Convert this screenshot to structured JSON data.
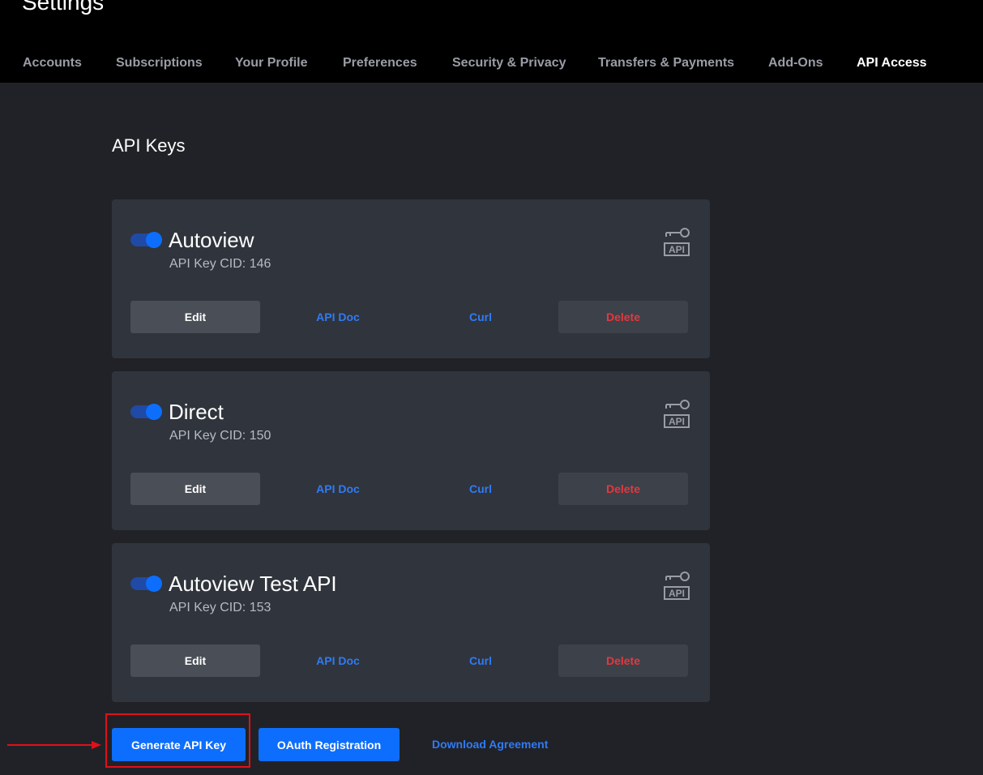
{
  "header": {
    "title": "Settings",
    "tabs": [
      {
        "label": "Accounts"
      },
      {
        "label": "Subscriptions"
      },
      {
        "label": "Your Profile"
      },
      {
        "label": "Preferences"
      },
      {
        "label": "Security & Privacy"
      },
      {
        "label": "Transfers & Payments"
      },
      {
        "label": "Add-Ons"
      },
      {
        "label": "API Access",
        "active": true
      }
    ]
  },
  "main": {
    "section_title": "API Keys",
    "keys": [
      {
        "name": "Autoview",
        "cid": "API Key CID: 146",
        "enabled": true,
        "edit": "Edit",
        "api_doc": "API Doc",
        "curl": "Curl",
        "delete": "Delete",
        "icon_label": "API"
      },
      {
        "name": "Direct",
        "cid": "API Key CID: 150",
        "enabled": true,
        "edit": "Edit",
        "api_doc": "API Doc",
        "curl": "Curl",
        "delete": "Delete",
        "icon_label": "API"
      },
      {
        "name": "Autoview Test API",
        "cid": "API Key CID: 153",
        "enabled": true,
        "edit": "Edit",
        "api_doc": "API Doc",
        "curl": "Curl",
        "delete": "Delete",
        "icon_label": "API"
      }
    ],
    "actions": {
      "generate": "Generate API Key",
      "oauth": "OAuth Registration",
      "download": "Download Agreement"
    }
  },
  "colors": {
    "background": "#212227",
    "card": "#30343c",
    "accent": "#0d6efd",
    "link": "#2f7bf5",
    "danger": "#e8363d",
    "annotation": "#e0101a"
  },
  "icons": [
    "key-api-icon",
    "toggle-switch",
    "red-arrow"
  ]
}
